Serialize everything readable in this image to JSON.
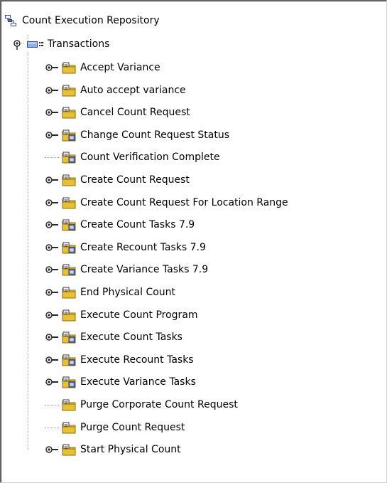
{
  "tree": {
    "root": {
      "label": "Count Execution Repository",
      "icon": "repository-icon"
    },
    "folder": {
      "label": "Transactions",
      "icon": "transactions-folder-icon",
      "expanded": true
    },
    "items": [
      {
        "label": "Accept Variance",
        "icon": "transaction-icon",
        "expandable": true
      },
      {
        "label": "Auto accept variance",
        "icon": "transaction-icon",
        "expandable": true
      },
      {
        "label": "Cancel Count Request",
        "icon": "transaction-icon",
        "expandable": true
      },
      {
        "label": "Change Count Request Status",
        "icon": "transaction-form-icon",
        "expandable": true
      },
      {
        "label": "Count Verification Complete",
        "icon": "transaction-form-icon",
        "expandable": false
      },
      {
        "label": "Create Count Request",
        "icon": "transaction-icon",
        "expandable": true
      },
      {
        "label": "Create Count Request For Location Range",
        "icon": "transaction-icon",
        "expandable": true
      },
      {
        "label": "Create Count Tasks 7.9",
        "icon": "transaction-form-icon",
        "expandable": true
      },
      {
        "label": "Create Recount Tasks 7.9",
        "icon": "transaction-form-icon",
        "expandable": true
      },
      {
        "label": "Create Variance Tasks 7.9",
        "icon": "transaction-form-icon",
        "expandable": true
      },
      {
        "label": "End Physical Count",
        "icon": "transaction-icon",
        "expandable": true
      },
      {
        "label": "Execute Count Program",
        "icon": "transaction-icon",
        "expandable": true
      },
      {
        "label": "Execute Count Tasks",
        "icon": "transaction-form-icon",
        "expandable": true
      },
      {
        "label": "Execute Recount Tasks",
        "icon": "transaction-form-icon",
        "expandable": true
      },
      {
        "label": "Execute Variance Tasks",
        "icon": "transaction-form-icon",
        "expandable": true
      },
      {
        "label": "Purge Corporate Count Request",
        "icon": "transaction-icon",
        "expandable": false
      },
      {
        "label": "Purge Count Request",
        "icon": "transaction-icon",
        "expandable": false
      },
      {
        "label": "Start Physical Count",
        "icon": "transaction-icon",
        "expandable": true
      }
    ]
  }
}
